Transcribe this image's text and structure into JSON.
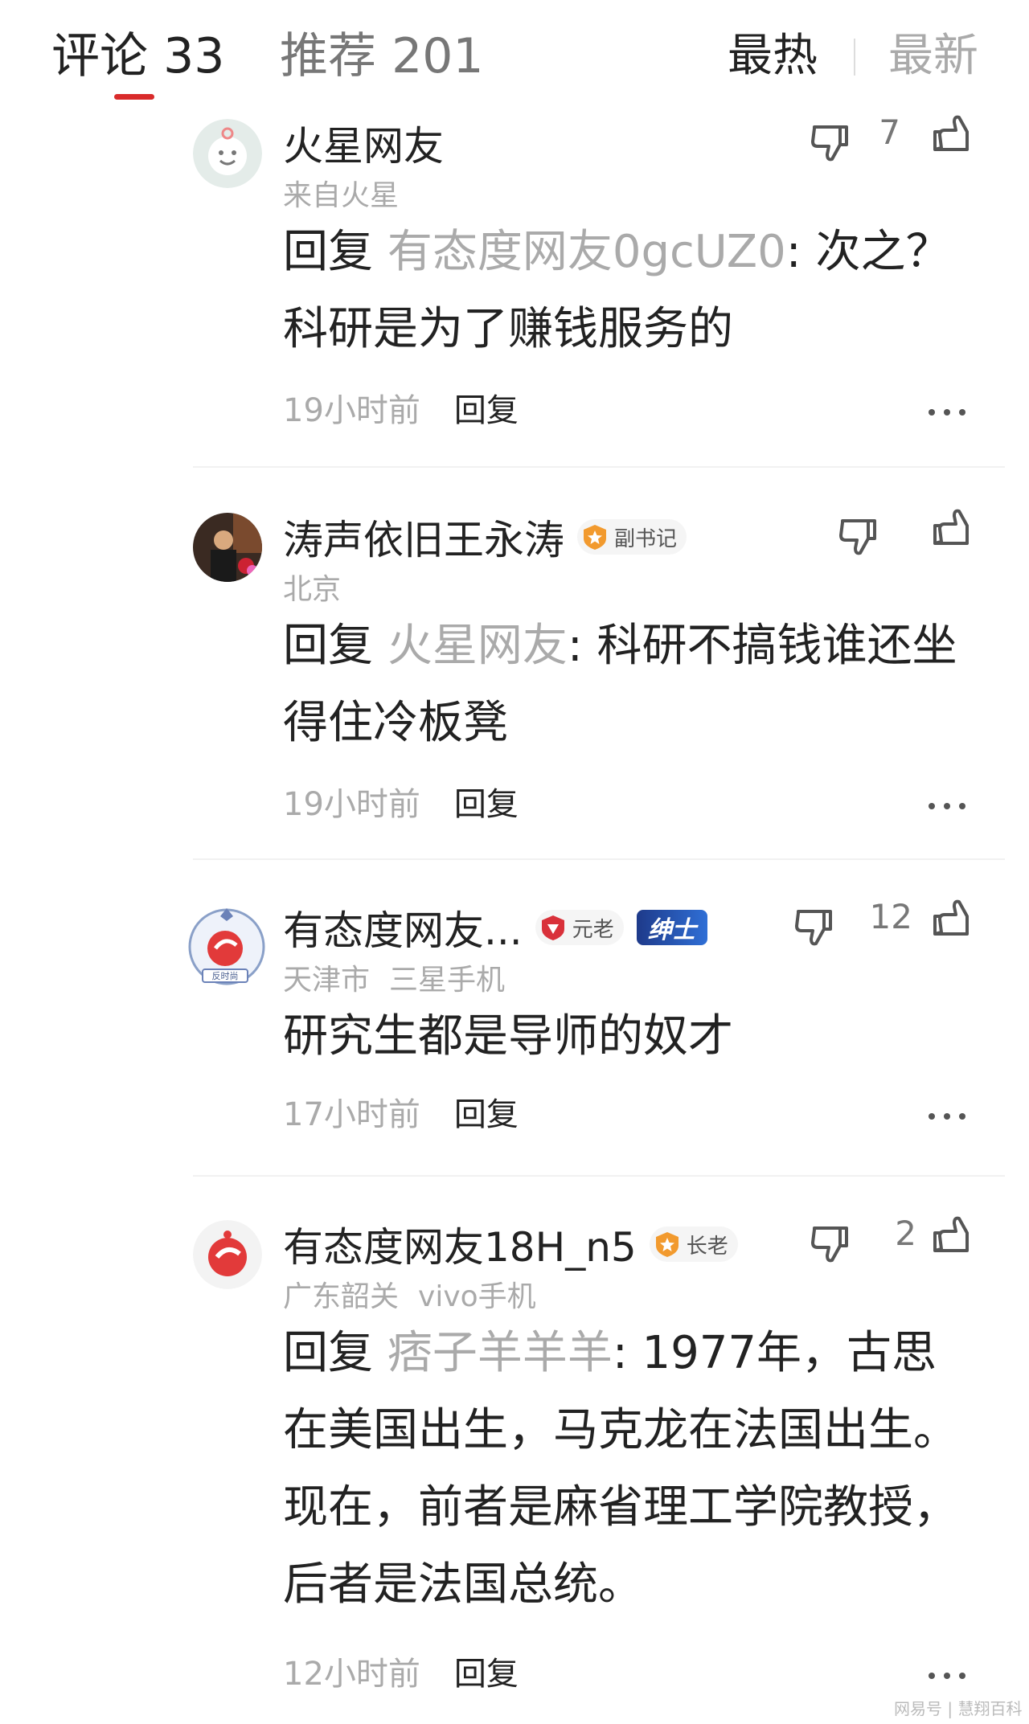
{
  "tabs": {
    "comments": "评论 33",
    "recommend": "推荐 201",
    "sort_hot": "最热",
    "sort_new": "最新"
  },
  "colors": {
    "accent": "#d92b2b",
    "muted": "#aaaaaa",
    "text": "#222222"
  },
  "comments": [
    {
      "name": "火星网友",
      "location": "来自火星",
      "device": "",
      "reply_prefix": "回复",
      "reply_to": "有态度网友0gcUZ0",
      "text": ": 次之？科研是为了赚钱服务的",
      "time": "19小时前",
      "reply_label": "回复",
      "likes": "7",
      "badges": []
    },
    {
      "name": "涛声依旧王永涛",
      "location": "北京",
      "device": "",
      "reply_prefix": "回复",
      "reply_to": "火星网友",
      "text": ": 科研不搞钱谁还坐得住冷板凳",
      "time": "19小时前",
      "reply_label": "回复",
      "likes": "",
      "badges": [
        "副书记"
      ]
    },
    {
      "name": "有态度网友...",
      "location": "天津市",
      "device": "三星手机",
      "reply_prefix": "",
      "reply_to": "",
      "text": "研究生都是导师的奴才",
      "time": "17小时前",
      "reply_label": "回复",
      "likes": "12",
      "badges": [
        "元老",
        "绅士"
      ]
    },
    {
      "name": "有态度网友18H_n5",
      "location": "广东韶关",
      "device": "vivo手机",
      "reply_prefix": "回复",
      "reply_to": "痞子羊羊羊",
      "text": ": 1977年，古思在美国出生，马克龙在法国出生。现在，前者是麻省理工学院教授，后者是法国总统。",
      "time": "12小时前",
      "reply_label": "回复",
      "likes": "2",
      "badges": [
        "长老"
      ]
    }
  ],
  "avatar_texts": {
    "c2": "反时尚"
  },
  "watermark": "网易号 | 慧翔百科",
  "icons": [
    "thumb-down-icon",
    "thumb-up-icon",
    "more-icon"
  ]
}
